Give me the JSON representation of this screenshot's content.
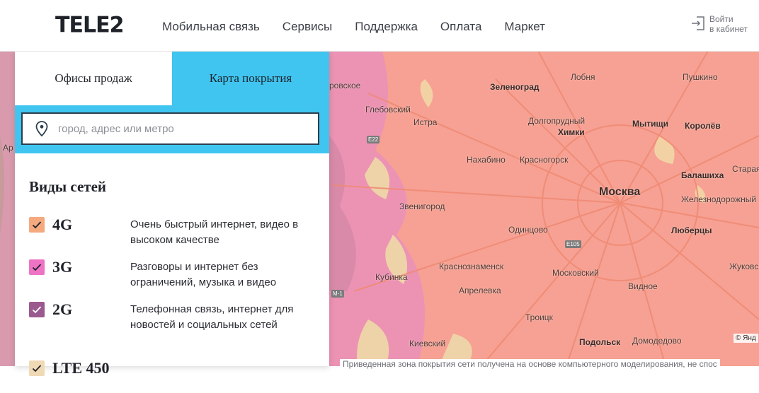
{
  "header": {
    "logo": "TELE2",
    "nav": [
      "Мобильная связь",
      "Сервисы",
      "Поддержка",
      "Оплата",
      "Маркет"
    ],
    "login": {
      "line1": "Войти",
      "line2": "в кабинет",
      "icon": "login-icon"
    }
  },
  "panel": {
    "tabs": {
      "offices": "Офисы продаж",
      "coverage": "Карта покрытия"
    },
    "search": {
      "placeholder": "город, адрес или метро",
      "value": "",
      "icon": "location-pin-icon"
    },
    "networks_title": "Виды сетей",
    "networks": [
      {
        "name": "4G",
        "desc": "Очень быстрый интернет, видео в высоком качестве",
        "color": "#f5a97f",
        "checked": true
      },
      {
        "name": "3G",
        "desc": "Разговоры и интернет без ограничений, музыка и видео",
        "color": "#ef73c4",
        "checked": true
      },
      {
        "name": "2G",
        "desc": "Телефонная связь, интернет для новостей и социальных сетей",
        "color": "#9b5a8f",
        "checked": true
      },
      {
        "name": "LTE 450",
        "desc": "",
        "color": "#f0d9b5",
        "checked": true
      }
    ]
  },
  "map": {
    "labels": {
      "zelenograd": "Зеленоград",
      "lobnya": "Лобня",
      "pushkino": "Пушкино",
      "glebovsky": "Глебовский",
      "istra": "Истра",
      "dolgoprudny": "Долгопрудный",
      "khimki": "Химки",
      "mytishchi": "Мытищи",
      "korolev": "Королёв",
      "nakhabino": "Нахабино",
      "krasnogorsk": "Красногорск",
      "balashikha": "Балашиха",
      "staraya": "Старая",
      "zheleznodorozhny": "Железнодорожный",
      "moskva": "Москва",
      "zvenigorod": "Звенигород",
      "odintsovo": "Одинцово",
      "lyubertsy": "Люберцы",
      "kubinka": "Кубинка",
      "krasnoznamensk": "Краснознаменск",
      "moskovsky": "Московский",
      "zhukovsky": "Жуковс",
      "aprelevka": "Апрелевка",
      "vidnoe": "Видное",
      "troitsk": "Троицк",
      "kievsky": "Киевский",
      "podolsk": "Подольск",
      "domodedovo": "Домодедово",
      "rovskoe": "ровское",
      "ar": "Ар"
    },
    "roads": {
      "e22": "E22",
      "e105": "E105",
      "m1": "М-1"
    },
    "copyright": "© Янд",
    "disclaimer": "Приведенная зона покрытия сети получена на основе компьютерного моделирования, не спос",
    "colors": {
      "coverage4g": "#f5998a",
      "coverage3g": "#ec8fb5",
      "coverage2g": "#c88aa8"
    }
  }
}
